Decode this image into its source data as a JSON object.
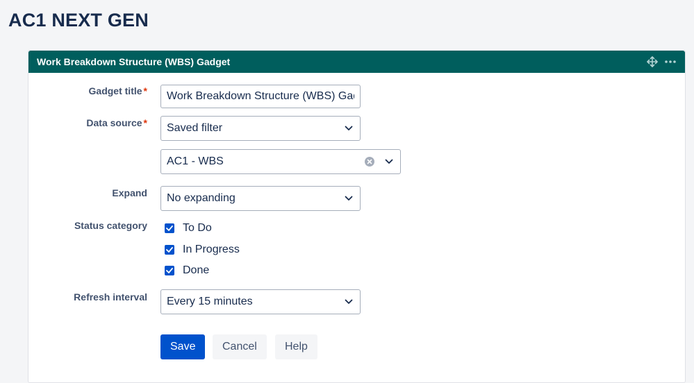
{
  "page": {
    "title": "AC1 NEXT GEN"
  },
  "gadget": {
    "title": "Work Breakdown Structure (WBS) Gadget",
    "header_color": "#005e5d",
    "icons": {
      "move": "move-icon",
      "more": "more-icon"
    }
  },
  "form": {
    "gadget_title": {
      "label": "Gadget title",
      "required": "*",
      "value": "Work Breakdown Structure (WBS) Gadget"
    },
    "data_source": {
      "label": "Data source",
      "required": "*",
      "value": "Saved filter",
      "filter_value": "AC1 - WBS"
    },
    "expand": {
      "label": "Expand",
      "value": "No expanding"
    },
    "status_category": {
      "label": "Status category",
      "options": [
        {
          "label": "To Do",
          "checked": true
        },
        {
          "label": "In Progress",
          "checked": true
        },
        {
          "label": "Done",
          "checked": true
        }
      ]
    },
    "refresh_interval": {
      "label": "Refresh interval",
      "value": "Every 15 minutes"
    }
  },
  "buttons": {
    "save": "Save",
    "cancel": "Cancel",
    "help": "Help"
  },
  "colors": {
    "primary": "#0052cc",
    "required": "#de350b"
  }
}
